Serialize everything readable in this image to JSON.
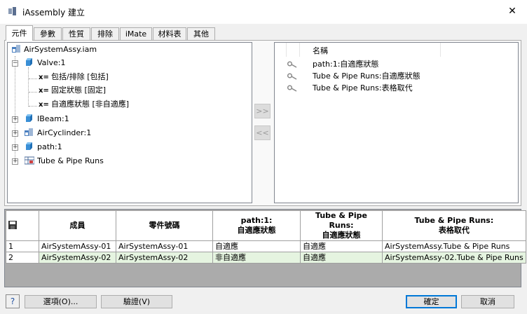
{
  "window": {
    "title": "iAssembly 建立",
    "close_glyph": "✕"
  },
  "tabs": [
    "元件",
    "參數",
    "性質",
    "排除",
    "iMate",
    "材料表",
    "其他"
  ],
  "tree": {
    "root": "AirSystemAssy.iam",
    "valve": "Valve:1",
    "valve_children": [
      {
        "icon": "x=",
        "label": "包括/排除 [包括]"
      },
      {
        "icon": "x=",
        "label": "固定狀態 [固定]"
      },
      {
        "icon": "x=",
        "label": "自適應狀態 [非自適應]"
      }
    ],
    "items": [
      "IBeam:1",
      "AirCyclinder:1",
      "path:1",
      "Tube & Pipe Runs"
    ],
    "expand_plus": "+",
    "expand_minus": "−"
  },
  "move_buttons": {
    "add": ">>",
    "remove": "<<"
  },
  "right_list": {
    "header": "名稱",
    "items": [
      "path:1:自適應狀態",
      "Tube & Pipe Runs:自適應狀態",
      "Tube & Pipe Runs:表格取代"
    ]
  },
  "grid": {
    "headers": [
      "成員",
      "零件號碼",
      "path:1:\n自適應狀態",
      "Tube & Pipe Runs:\n自適應狀態",
      "Tube & Pipe Runs:\n表格取代"
    ],
    "rows": [
      [
        "1",
        "AirSystemAssy-01",
        "AirSystemAssy-01",
        "自適應",
        "自適應",
        "AirSystemAssy.Tube & Pipe Runs"
      ],
      [
        "2",
        "AirSystemAssy-02",
        "AirSystemAssy-02",
        "非自適應",
        "自適應",
        "AirSystemAssy-02.Tube & Pipe Runs"
      ]
    ]
  },
  "buttons": {
    "help": "?",
    "options": "選項(O)...",
    "verify": "驗證(V)",
    "ok": "確定",
    "cancel": "取消"
  },
  "colors": {
    "cube_blue": "#3a8fd6",
    "row_highlight": "#e5f4e0",
    "default_button_border": "#0078d7"
  }
}
